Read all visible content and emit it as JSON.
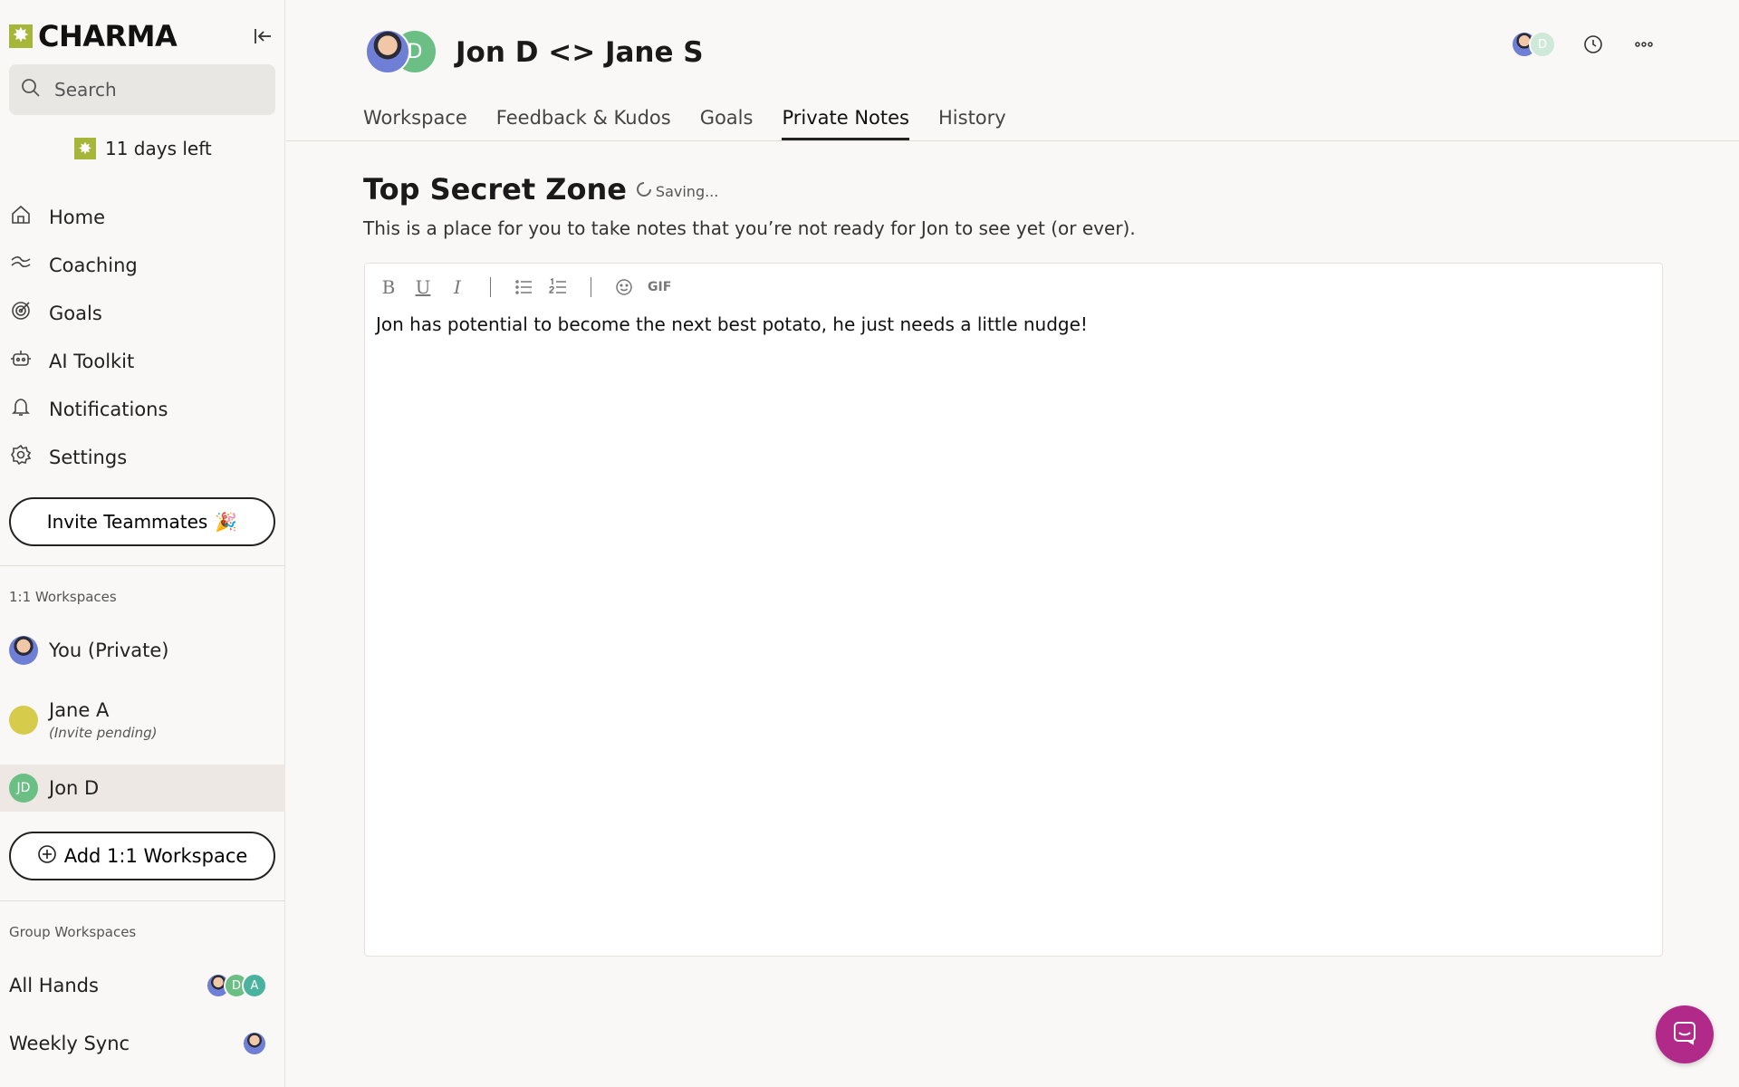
{
  "app": {
    "brand": "CHARMA",
    "brand_color": "#a6b63a"
  },
  "sidebar": {
    "search_placeholder": "Search",
    "trial_text": "11 days left",
    "nav": [
      {
        "label": "Home",
        "icon": "home-icon"
      },
      {
        "label": "Coaching",
        "icon": "coaching-icon"
      },
      {
        "label": "Goals",
        "icon": "target-icon"
      },
      {
        "label": "AI Toolkit",
        "icon": "robot-icon"
      },
      {
        "label": "Notifications",
        "icon": "bell-icon"
      },
      {
        "label": "Settings",
        "icon": "gear-icon"
      }
    ],
    "invite_label": "Invite Teammates",
    "invite_emoji": "🎉",
    "one_on_one_label": "1:1 Workspaces",
    "one_on_ones": [
      {
        "name": "You (Private)",
        "sub": ""
      },
      {
        "name": "Jane A",
        "sub": "(Invite pending)"
      },
      {
        "name": "Jon D",
        "sub": "",
        "initials": "JD",
        "active": true
      }
    ],
    "add_workspace_label": "Add 1:1 Workspace",
    "group_label": "Group Workspaces",
    "groups": [
      {
        "name": "All Hands",
        "avatars": [
          "photo",
          "D",
          "A"
        ]
      },
      {
        "name": "Weekly Sync",
        "avatars": [
          "photo"
        ]
      }
    ]
  },
  "header": {
    "title": "Jon D <> Jane S",
    "avatar_initial": "D"
  },
  "top_right": {
    "mini_avatar_initial": "D"
  },
  "tabs": [
    {
      "label": "Workspace",
      "active": false
    },
    {
      "label": "Feedback & Kudos",
      "active": false
    },
    {
      "label": "Goals",
      "active": false
    },
    {
      "label": "Private Notes",
      "active": true
    },
    {
      "label": "History",
      "active": false
    }
  ],
  "notes": {
    "title": "Top Secret Zone",
    "status": "Saving...",
    "description": "This is a place for you to take notes that you’re not ready for Jon to see yet (or ever).",
    "content": "Jon has potential to become the next best potato, he just needs a little nudge!",
    "toolbar": {
      "bold": "B",
      "underline": "U",
      "italic": "I",
      "gif": "GIF"
    }
  },
  "colors": {
    "chat_button": "#b12a8a",
    "avatar_green": "#6bbf84",
    "avatar_teal": "#4ab3a0"
  }
}
